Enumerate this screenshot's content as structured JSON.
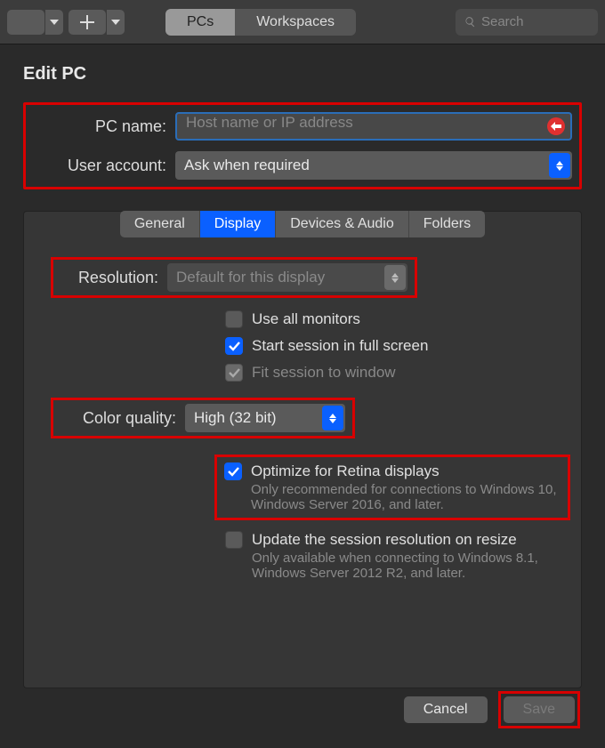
{
  "toolbar": {
    "tabs": {
      "pcs": "PCs",
      "workspaces": "Workspaces"
    },
    "search_placeholder": "Search"
  },
  "page": {
    "title": "Edit PC"
  },
  "form": {
    "pc_name_label": "PC name:",
    "pc_name_placeholder": "Host name or IP address",
    "user_account_label": "User account:",
    "user_account_value": "Ask when required"
  },
  "tabs": {
    "general": "General",
    "display": "Display",
    "devices": "Devices & Audio",
    "folders": "Folders"
  },
  "display": {
    "resolution_label": "Resolution:",
    "resolution_value": "Default for this display",
    "use_all_monitors": "Use all monitors",
    "full_screen": "Start session in full screen",
    "fit_window": "Fit session to window",
    "color_quality_label": "Color quality:",
    "color_quality_value": "High (32 bit)",
    "retina_label": "Optimize for Retina displays",
    "retina_sub": "Only recommended for connections to Windows 10, Windows Server 2016, and later.",
    "resize_label": "Update the session resolution on resize",
    "resize_sub": "Only available when connecting to Windows 8.1, Windows Server 2012 R2, and later."
  },
  "buttons": {
    "cancel": "Cancel",
    "save": "Save"
  }
}
